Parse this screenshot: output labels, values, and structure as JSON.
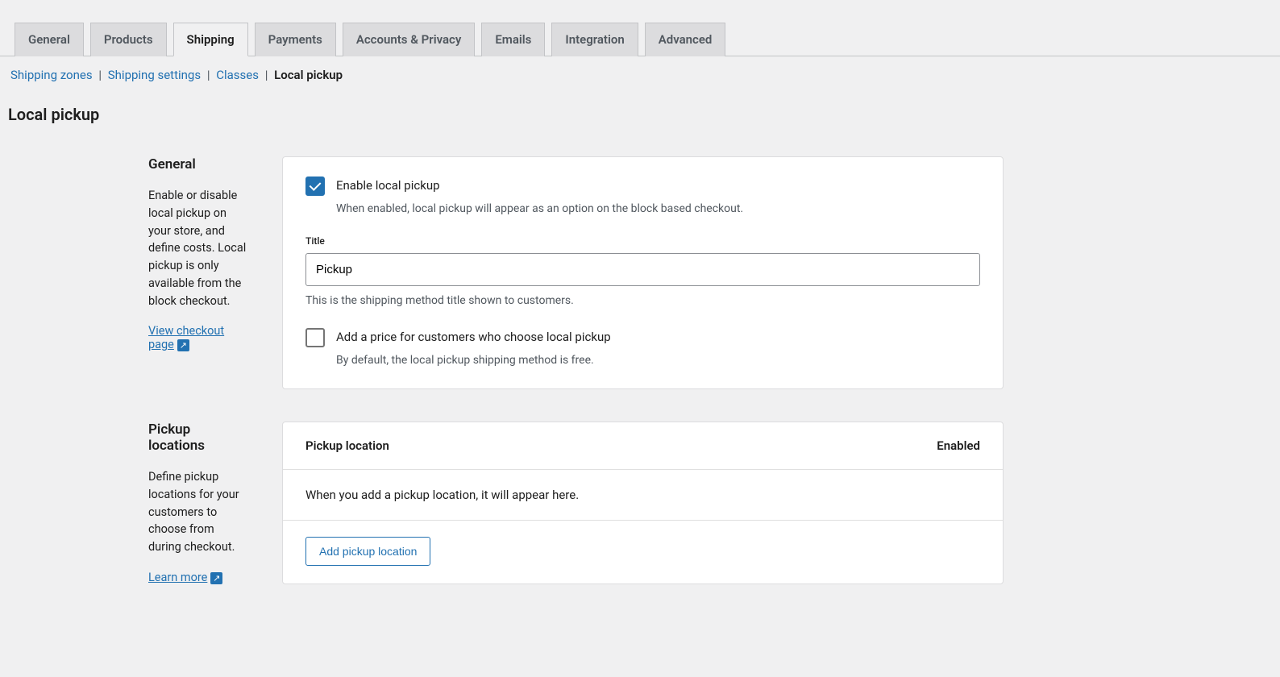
{
  "tabs": {
    "general": "General",
    "products": "Products",
    "shipping": "Shipping",
    "payments": "Payments",
    "accounts": "Accounts & Privacy",
    "emails": "Emails",
    "integration": "Integration",
    "advanced": "Advanced"
  },
  "subnav": {
    "shipping_zones": "Shipping zones",
    "shipping_settings": "Shipping settings",
    "classes": "Classes",
    "local_pickup": "Local pickup"
  },
  "page_title": "Local pickup",
  "general_section": {
    "heading": "General",
    "description": "Enable or disable local pickup on your store, and define costs. Local pickup is only available from the block checkout.",
    "link_text": "View checkout page"
  },
  "general_panel": {
    "enable_label": "Enable local pickup",
    "enable_help": "When enabled, local pickup will appear as an option on the block based checkout.",
    "title_label": "Title",
    "title_value": "Pickup",
    "title_help": "This is the shipping method title shown to customers.",
    "price_label": "Add a price for customers who choose local pickup",
    "price_help": "By default, the local pickup shipping method is free."
  },
  "locations_section": {
    "heading": "Pickup locations",
    "description": "Define pickup locations for your customers to choose from during checkout.",
    "link_text": "Learn more"
  },
  "locations_panel": {
    "col_location": "Pickup location",
    "col_enabled": "Enabled",
    "empty_text": "When you add a pickup location, it will appear here.",
    "add_button": "Add pickup location"
  }
}
